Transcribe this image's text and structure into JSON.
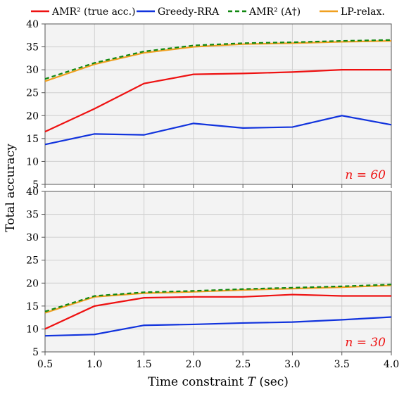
{
  "chart_data": [
    {
      "type": "line",
      "title": "",
      "annotation": "n = 60",
      "xlabel": "",
      "ylabel": "",
      "x": [
        0.5,
        1.0,
        1.5,
        2.0,
        2.5,
        3.0,
        3.5,
        4.0
      ],
      "xlim": [
        0.5,
        4.0
      ],
      "ylim": [
        5,
        40
      ],
      "xticks": [
        0.5,
        1.0,
        1.5,
        2.0,
        2.5,
        3.0,
        3.5,
        4.0
      ],
      "yticks": [
        5,
        10,
        15,
        20,
        25,
        30,
        35,
        40
      ],
      "series": [
        {
          "name": "AMR² (true acc.)",
          "color": "#ee1111",
          "dash": "",
          "values": [
            16.5,
            21.5,
            27.0,
            29.0,
            29.2,
            29.5,
            30.0,
            30.0
          ]
        },
        {
          "name": "Greedy-RRA",
          "color": "#1133dd",
          "dash": "",
          "values": [
            13.7,
            16.0,
            15.8,
            18.3,
            17.3,
            17.5,
            20.0,
            18.0
          ]
        },
        {
          "name": "AMR² (A†)",
          "color": "#118811",
          "dash": "6,4",
          "values": [
            28.0,
            31.5,
            34.0,
            35.3,
            35.8,
            36.0,
            36.3,
            36.5
          ]
        },
        {
          "name": "LP-relax.",
          "color": "#f0a020",
          "dash": "",
          "values": [
            27.5,
            31.2,
            33.7,
            35.0,
            35.6,
            35.8,
            36.1,
            36.3
          ]
        }
      ]
    },
    {
      "type": "line",
      "title": "",
      "annotation": "n = 30",
      "xlabel": "Time constraint T (sec)",
      "ylabel": "",
      "x": [
        0.5,
        1.0,
        1.5,
        2.0,
        2.5,
        3.0,
        3.5,
        4.0
      ],
      "xlim": [
        0.5,
        4.0
      ],
      "ylim": [
        5,
        40
      ],
      "xticks": [
        0.5,
        1.0,
        1.5,
        2.0,
        2.5,
        3.0,
        3.5,
        4.0
      ],
      "yticks": [
        5,
        10,
        15,
        20,
        25,
        30,
        35,
        40
      ],
      "series": [
        {
          "name": "AMR² (true acc.)",
          "color": "#ee1111",
          "dash": "",
          "values": [
            10.0,
            15.0,
            16.8,
            17.0,
            17.0,
            17.5,
            17.2,
            17.2
          ]
        },
        {
          "name": "Greedy-RRA",
          "color": "#1133dd",
          "dash": "",
          "values": [
            8.5,
            8.8,
            10.8,
            11.0,
            11.3,
            11.5,
            12.0,
            12.6
          ]
        },
        {
          "name": "AMR² (A†)",
          "color": "#118811",
          "dash": "6,4",
          "values": [
            13.8,
            17.2,
            18.0,
            18.3,
            18.7,
            19.0,
            19.3,
            19.7
          ]
        },
        {
          "name": "LP-relax.",
          "color": "#f0a020",
          "dash": "",
          "values": [
            13.5,
            17.0,
            17.8,
            18.1,
            18.5,
            18.8,
            19.1,
            19.5
          ]
        }
      ]
    }
  ],
  "shared_ylabel": "Total accuracy",
  "legend": {
    "items": [
      {
        "label": "AMR² (true acc.)",
        "color": "#ee1111",
        "dash": ""
      },
      {
        "label": "Greedy-RRA",
        "color": "#1133dd",
        "dash": ""
      },
      {
        "label": "AMR² (A†)",
        "color": "#118811",
        "dash": "6,4"
      },
      {
        "label": "LP-relax.",
        "color": "#f0a020",
        "dash": ""
      }
    ]
  },
  "xtick_labels": [
    "0.5",
    "1.0",
    "1.5",
    "2.0",
    "2.5",
    "3.0",
    "3.5",
    "4.0"
  ],
  "ytick_labels": [
    "5",
    "10",
    "15",
    "20",
    "25",
    "30",
    "35",
    "40"
  ]
}
